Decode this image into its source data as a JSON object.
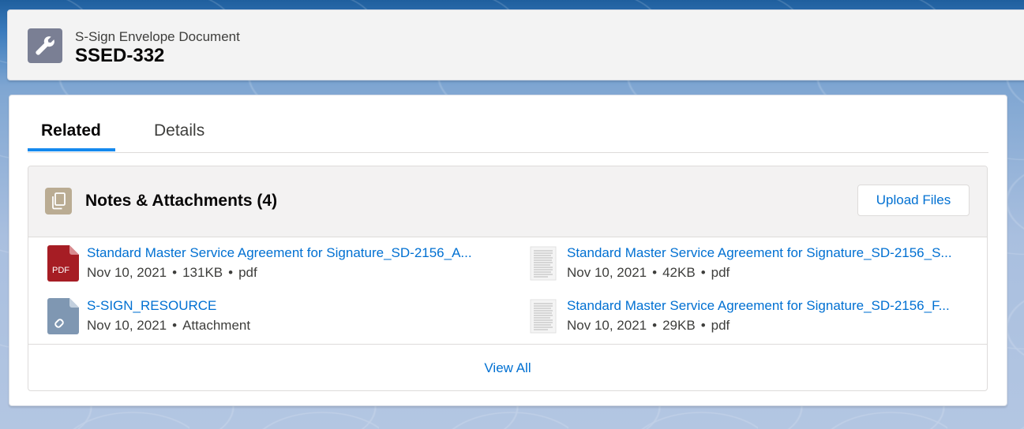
{
  "header": {
    "object_type": "S-Sign Envelope Document",
    "record_name": "SSED-332",
    "icon": "wrench-icon"
  },
  "tabs": [
    {
      "label": "Related",
      "active": true
    },
    {
      "label": "Details",
      "active": false
    }
  ],
  "related_list": {
    "title": "Notes & Attachments (4)",
    "icon": "attachments-icon",
    "upload_label": "Upload Files",
    "view_all_label": "View All",
    "items": [
      {
        "name": "Standard Master Service Agreement for Signature_SD-2156_A...",
        "date": "Nov 10, 2021",
        "size": "131KB",
        "type": "pdf",
        "icon": "pdf-icon",
        "icon_label": "PDF"
      },
      {
        "name": "Standard Master Service Agreement for Signature_SD-2156_S...",
        "date": "Nov 10, 2021",
        "size": "42KB",
        "type": "pdf",
        "icon": "document-thumbnail-icon"
      },
      {
        "name": "S-SIGN_RESOURCE",
        "date": "Nov 10, 2021",
        "type": "Attachment",
        "icon": "link-attachment-icon"
      },
      {
        "name": "Standard Master Service Agreement for Signature_SD-2156_F...",
        "date": "Nov 10, 2021",
        "size": "29KB",
        "type": "pdf",
        "icon": "document-thumbnail-icon"
      }
    ]
  },
  "colors": {
    "link": "#0070d2",
    "tab_active_underline": "#1589ee",
    "header_icon_bg": "#7a7f94",
    "attachments_icon_bg": "#baac93",
    "pdf_icon_bg": "#a61d24",
    "attachment_icon_bg": "#7f97b2"
  }
}
